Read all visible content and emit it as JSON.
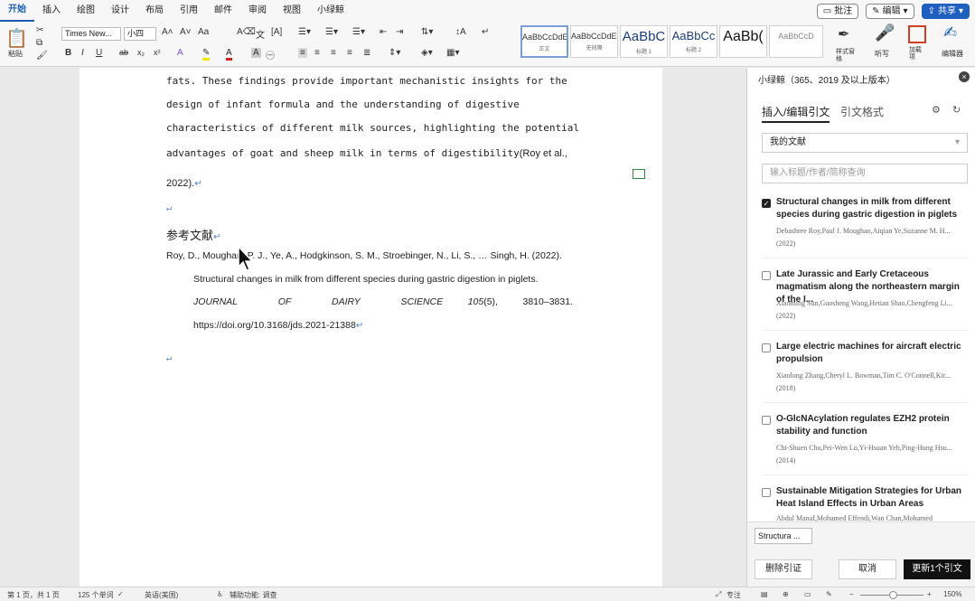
{
  "menu": {
    "tabs": [
      "开始",
      "插入",
      "绘图",
      "设计",
      "布局",
      "引用",
      "邮件",
      "审阅",
      "视图",
      "小绿鲸"
    ],
    "comment": "批注",
    "edit": "编辑",
    "share": "共享"
  },
  "ribbon": {
    "paste": "粘贴",
    "font_name": "Times New...",
    "font_size": "小四",
    "styles": [
      {
        "preview": "AaBbCcDdEe",
        "name": "正文"
      },
      {
        "preview": "AaBbCcDdEe",
        "name": "无间隔"
      },
      {
        "preview": "AaBbC",
        "name": "标题 1"
      },
      {
        "preview": "AaBbCc",
        "name": "标题 2"
      },
      {
        "preview": "AaBb(",
        "name": ""
      },
      {
        "preview": "AaBbCcD",
        "name": ""
      }
    ],
    "style_pane": "样式窗格",
    "dictate": "听写",
    "addins": "加载项",
    "editor": "编辑器"
  },
  "document": {
    "lines": [
      "fats. These findings provide important mechanistic insights for the",
      "design of infant formula and the understanding of digestive",
      "characteristics of different milk sources, highlighting the potential",
      "advantages of goat and sheep milk in terms of digestibility"
    ],
    "citation_tail": "(Roy et al.,",
    "citation_year": "2022).",
    "ref_heading": "参考文献",
    "ref_line1": "Roy, D., Moughan, P. J., Ye, A., Hodgkinson, S. M., Stroebinger, N., Li, S., … Singh, H. (2022).",
    "ref_line2": "Structural changes in milk from different species during gastric digestion in piglets.",
    "ref_journal": "JOURNAL OF DAIRY SCIENCE",
    "ref_vol": "105",
    "ref_issue": "(5),",
    "ref_pages": "3810–3831.",
    "ref_doi": "https://doi.org/10.3168/jds.2021-21388",
    "para_mark": "↵"
  },
  "panel": {
    "title": "小绿鲸（365、2019 及以上版本）",
    "tab_insert": "插入/编辑引文",
    "tab_format": "引文格式",
    "library": "我的文献",
    "search_placeholder": "输入标题/作者/简称查询",
    "items": [
      {
        "title": "Structural changes in milk from different species during gastric digestion in piglets",
        "authors": "Debashree Roy,Paul J. Moughan,Aiqian Ye,Suzanne M. H...",
        "year": "(2022)",
        "checked": true
      },
      {
        "title": "Late Jurassic and Early Cretaceous magmatism along the northeastern margin of the I...",
        "authors": "Xiaoming Sun,Guosheng Wang,Hetian Shao,Chengfeng Li...",
        "year": "(2022)",
        "checked": false
      },
      {
        "title": "Large electric machines for aircraft electric propulsion",
        "authors": "Xiaolong Zhang,Cheryl L. Bowman,Tim C. O'Connell,Kir...",
        "year": "(2018)",
        "checked": false
      },
      {
        "title": "O-GlcNAcylation regulates EZH2 protein stability and function",
        "authors": "Chi-Shuen Chu,Pei-Wen Lo,Yi-Hsuan Yeh,Ping-Hung Hsu...",
        "year": "(2014)",
        "checked": false
      },
      {
        "title": "Sustainable Mitigation Strategies for Urban Heat Island Effects in Urban Areas",
        "authors": "Abdul Manaf,Mohamed Effendi,Wan Chan,Mohamed",
        "year": "",
        "checked": false
      }
    ],
    "chip": "Structura ...",
    "remove": "删除引证",
    "cancel": "取消",
    "update": "更新1个引文"
  },
  "status": {
    "page": "第 1 页，共 1 页",
    "words": "125 个单词",
    "lang": "英语(美国)",
    "access": "辅助功能: 调查",
    "focus": "专注",
    "zoom": "150%"
  }
}
